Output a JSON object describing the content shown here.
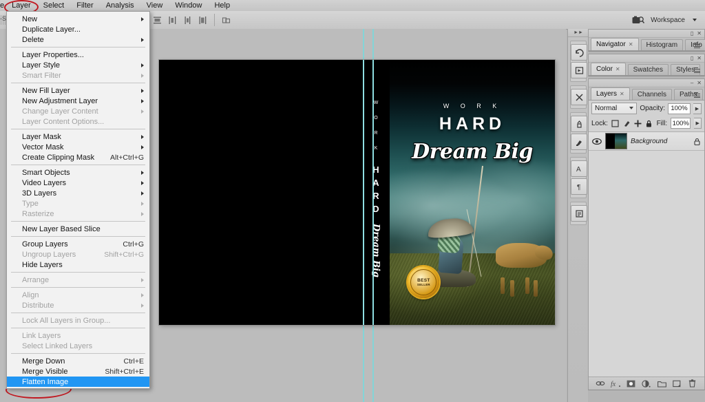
{
  "app": {
    "name": "Adobe Photoshop",
    "accent_selection": "#2196f3",
    "annotation_color": "#c11a22",
    "guide_color": "#7fd6d8"
  },
  "menubar": {
    "clipped_left": "e",
    "items": [
      {
        "label": "Layer",
        "active": true,
        "circled": true
      },
      {
        "label": "Select",
        "active": false
      },
      {
        "label": "Filter",
        "active": false
      },
      {
        "label": "Analysis",
        "active": false
      },
      {
        "label": "View",
        "active": false
      },
      {
        "label": "Window",
        "active": false
      },
      {
        "label": "Help",
        "active": false
      }
    ]
  },
  "stray_text": "-Se",
  "options_bar": {
    "align_buttons": [
      {
        "name": "align-top-edges",
        "title": "Align top edges"
      },
      {
        "name": "align-vertical-centers",
        "title": "Align vertical centers"
      },
      {
        "name": "align-bottom-edges",
        "title": "Align bottom edges"
      },
      {
        "name": "align-left-edges",
        "title": "Align left edges"
      },
      {
        "name": "align-horizontal-centers",
        "title": "Align horizontal centers"
      },
      {
        "name": "align-right-edges",
        "title": "Align right edges"
      }
    ],
    "distribute_buttons": [
      {
        "name": "distribute-top-edges",
        "title": "Distribute top edges"
      },
      {
        "name": "distribute-vertical-centers",
        "title": "Distribute vertical centers"
      },
      {
        "name": "distribute-bottom-edges",
        "title": "Distribute bottom edges"
      },
      {
        "name": "distribute-left-edges",
        "title": "Distribute left edges"
      },
      {
        "name": "distribute-horizontal-centers",
        "title": "Distribute horizontal centers"
      },
      {
        "name": "distribute-right-edges",
        "title": "Distribute right edges"
      }
    ],
    "auto_align_button": {
      "name": "auto-align-layers",
      "title": "Auto-align layers"
    },
    "workspace_label": "Workspace",
    "workspace_icon": "screen-mode-icon"
  },
  "layer_menu": {
    "sections": [
      [
        {
          "label": "New",
          "submenu": true,
          "disabled": false,
          "shortcut": ""
        },
        {
          "label": "Duplicate Layer...",
          "submenu": false,
          "disabled": false,
          "shortcut": ""
        },
        {
          "label": "Delete",
          "submenu": true,
          "disabled": false,
          "shortcut": ""
        }
      ],
      [
        {
          "label": "Layer Properties...",
          "submenu": false,
          "disabled": false,
          "shortcut": ""
        },
        {
          "label": "Layer Style",
          "submenu": true,
          "disabled": false,
          "shortcut": ""
        },
        {
          "label": "Smart Filter",
          "submenu": true,
          "disabled": true,
          "shortcut": ""
        }
      ],
      [
        {
          "label": "New Fill Layer",
          "submenu": true,
          "disabled": false,
          "shortcut": ""
        },
        {
          "label": "New Adjustment Layer",
          "submenu": true,
          "disabled": false,
          "shortcut": ""
        },
        {
          "label": "Change Layer Content",
          "submenu": true,
          "disabled": true,
          "shortcut": ""
        },
        {
          "label": "Layer Content Options...",
          "submenu": false,
          "disabled": true,
          "shortcut": ""
        }
      ],
      [
        {
          "label": "Layer Mask",
          "submenu": true,
          "disabled": false,
          "shortcut": ""
        },
        {
          "label": "Vector Mask",
          "submenu": true,
          "disabled": false,
          "shortcut": ""
        },
        {
          "label": "Create Clipping Mask",
          "submenu": false,
          "disabled": false,
          "shortcut": "Alt+Ctrl+G"
        }
      ],
      [
        {
          "label": "Smart Objects",
          "submenu": true,
          "disabled": false,
          "shortcut": ""
        },
        {
          "label": "Video Layers",
          "submenu": true,
          "disabled": false,
          "shortcut": ""
        },
        {
          "label": "3D Layers",
          "submenu": true,
          "disabled": false,
          "shortcut": ""
        },
        {
          "label": "Type",
          "submenu": true,
          "disabled": true,
          "shortcut": ""
        },
        {
          "label": "Rasterize",
          "submenu": true,
          "disabled": true,
          "shortcut": ""
        }
      ],
      [
        {
          "label": "New Layer Based Slice",
          "submenu": false,
          "disabled": false,
          "shortcut": ""
        }
      ],
      [
        {
          "label": "Group Layers",
          "submenu": false,
          "disabled": false,
          "shortcut": "Ctrl+G"
        },
        {
          "label": "Ungroup Layers",
          "submenu": false,
          "disabled": true,
          "shortcut": "Shift+Ctrl+G"
        },
        {
          "label": "Hide Layers",
          "submenu": false,
          "disabled": false,
          "shortcut": ""
        }
      ],
      [
        {
          "label": "Arrange",
          "submenu": true,
          "disabled": true,
          "shortcut": ""
        }
      ],
      [
        {
          "label": "Align",
          "submenu": true,
          "disabled": true,
          "shortcut": ""
        },
        {
          "label": "Distribute",
          "submenu": true,
          "disabled": true,
          "shortcut": ""
        }
      ],
      [
        {
          "label": "Lock All Layers in Group...",
          "submenu": false,
          "disabled": true,
          "shortcut": ""
        }
      ],
      [
        {
          "label": "Link Layers",
          "submenu": false,
          "disabled": true,
          "shortcut": ""
        },
        {
          "label": "Select Linked Layers",
          "submenu": false,
          "disabled": true,
          "shortcut": ""
        }
      ],
      [
        {
          "label": "Merge Down",
          "submenu": false,
          "disabled": false,
          "shortcut": "Ctrl+E"
        },
        {
          "label": "Merge Visible",
          "submenu": false,
          "disabled": false,
          "shortcut": "Shift+Ctrl+E"
        },
        {
          "label": "Flatten Image",
          "submenu": false,
          "disabled": false,
          "shortcut": "",
          "selected": true,
          "circled": true
        }
      ]
    ]
  },
  "document": {
    "cover_front": {
      "line_small": "W O R K",
      "line_big": "HARD",
      "line_script": "Dream Big"
    },
    "spine": {
      "work_letters": [
        "W",
        "O",
        "R",
        "K"
      ],
      "hard_letters": [
        "H",
        "A",
        "R",
        "D"
      ],
      "script": "Dream Big"
    },
    "badge": {
      "line1": "BEST",
      "line2": "SELLER",
      "ring_text": "BEST SELLER"
    },
    "guides": [
      "vertical-guide-1",
      "vertical-guide-2"
    ]
  },
  "icon_dock": {
    "groups": [
      [
        {
          "name": "history-icon",
          "glyph": "↺"
        },
        {
          "name": "actions-icon",
          "glyph": "▶"
        }
      ],
      [
        {
          "name": "tool-presets-icon",
          "glyph": "✂"
        }
      ],
      [
        {
          "name": "clone-source-icon",
          "glyph": "⚘"
        },
        {
          "name": "brushes-icon",
          "glyph": "✎"
        }
      ],
      [
        {
          "name": "character-icon",
          "glyph": "A"
        },
        {
          "name": "paragraph-icon",
          "glyph": "¶"
        }
      ],
      [
        {
          "name": "notes-icon",
          "glyph": "☰"
        }
      ]
    ]
  },
  "panels": [
    {
      "id": "navigator-group",
      "tabs": [
        {
          "label": "Navigator",
          "active": true,
          "closable": true
        },
        {
          "label": "Histogram",
          "active": false,
          "closable": false
        },
        {
          "label": "Info",
          "active": false,
          "closable": false
        }
      ]
    },
    {
      "id": "color-group",
      "tabs": [
        {
          "label": "Color",
          "active": true,
          "closable": true
        },
        {
          "label": "Swatches",
          "active": false,
          "closable": false
        },
        {
          "label": "Styles",
          "active": false,
          "closable": false
        }
      ]
    },
    {
      "id": "layers-group",
      "tabs": [
        {
          "label": "Layers",
          "active": true,
          "closable": true
        },
        {
          "label": "Channels",
          "active": false,
          "closable": false
        },
        {
          "label": "Paths",
          "active": false,
          "closable": false
        }
      ]
    }
  ],
  "layers_panel": {
    "blend_mode": "Normal",
    "opacity_label": "Opacity:",
    "opacity_value": "100%",
    "lock_label": "Lock:",
    "fill_label": "Fill:",
    "fill_value": "100%",
    "lock_buttons": [
      {
        "name": "lock-transparent-pixels-icon",
        "glyph": "□"
      },
      {
        "name": "lock-image-pixels-icon",
        "glyph": "✐"
      },
      {
        "name": "lock-position-icon",
        "glyph": "✚"
      },
      {
        "name": "lock-all-icon",
        "glyph": "ὑ2"
      }
    ],
    "rows": [
      {
        "name": "Background",
        "visible": true,
        "locked": true,
        "italic": true
      }
    ],
    "footer_buttons": [
      {
        "name": "link-layers-icon",
        "glyph": "∞"
      },
      {
        "name": "layer-style-fx-icon",
        "glyph": "fx"
      },
      {
        "name": "add-layer-mask-icon",
        "glyph": "●"
      },
      {
        "name": "new-adjustment-layer-icon",
        "glyph": "◑"
      },
      {
        "name": "new-group-icon",
        "glyph": "▭"
      },
      {
        "name": "new-layer-icon",
        "glyph": "⧉"
      },
      {
        "name": "delete-layer-icon",
        "glyph": "Ὕ1"
      }
    ]
  }
}
